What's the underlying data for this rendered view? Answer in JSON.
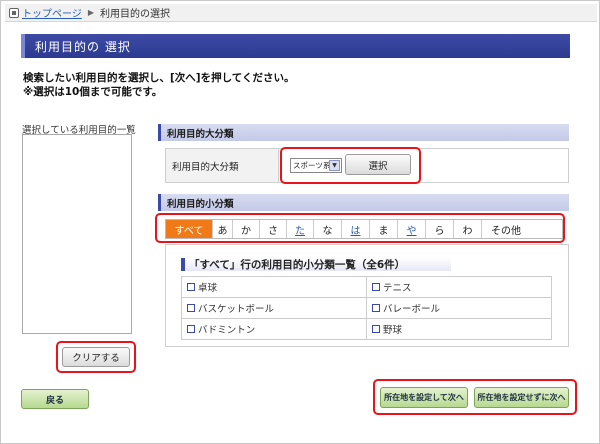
{
  "breadcrumb": {
    "home": "トップページ",
    "current": "利用目的の選択"
  },
  "title": "利用目的の 選択",
  "instructions": {
    "line1": "検索したい利用目的を選択し、[次へ]を押してください。",
    "line2": "※選択は10個まで可能です。"
  },
  "selected_list": {
    "label": "選択している利用目的一覧",
    "clear_button": "クリアする"
  },
  "large_category": {
    "header": "利用目的大分類",
    "label": "利用目的大分類",
    "selected_value": "スポーツ系",
    "select_button": "選択"
  },
  "small_category": {
    "header": "利用目的小分類",
    "tabs": [
      "すべて",
      "あ",
      "か",
      "さ",
      "た",
      "な",
      "は",
      "ま",
      "や",
      "ら",
      "わ",
      "その他"
    ],
    "panel_title": "「すべて」行の利用目的小分類一覧（全6件）",
    "items": [
      "卓球",
      "テニス",
      "バスケットボール",
      "バレーボール",
      "バドミントン",
      "野球"
    ]
  },
  "footer": {
    "back": "戻る",
    "next_with_location": "所在地を設定して次へ",
    "next_without_location": "所在地を設定せずに次へ"
  },
  "colors": {
    "title_bar": "#2c3a90",
    "active_tab": "#f07a17",
    "highlight": "#e8141b",
    "green_button": "#b6d98f"
  }
}
